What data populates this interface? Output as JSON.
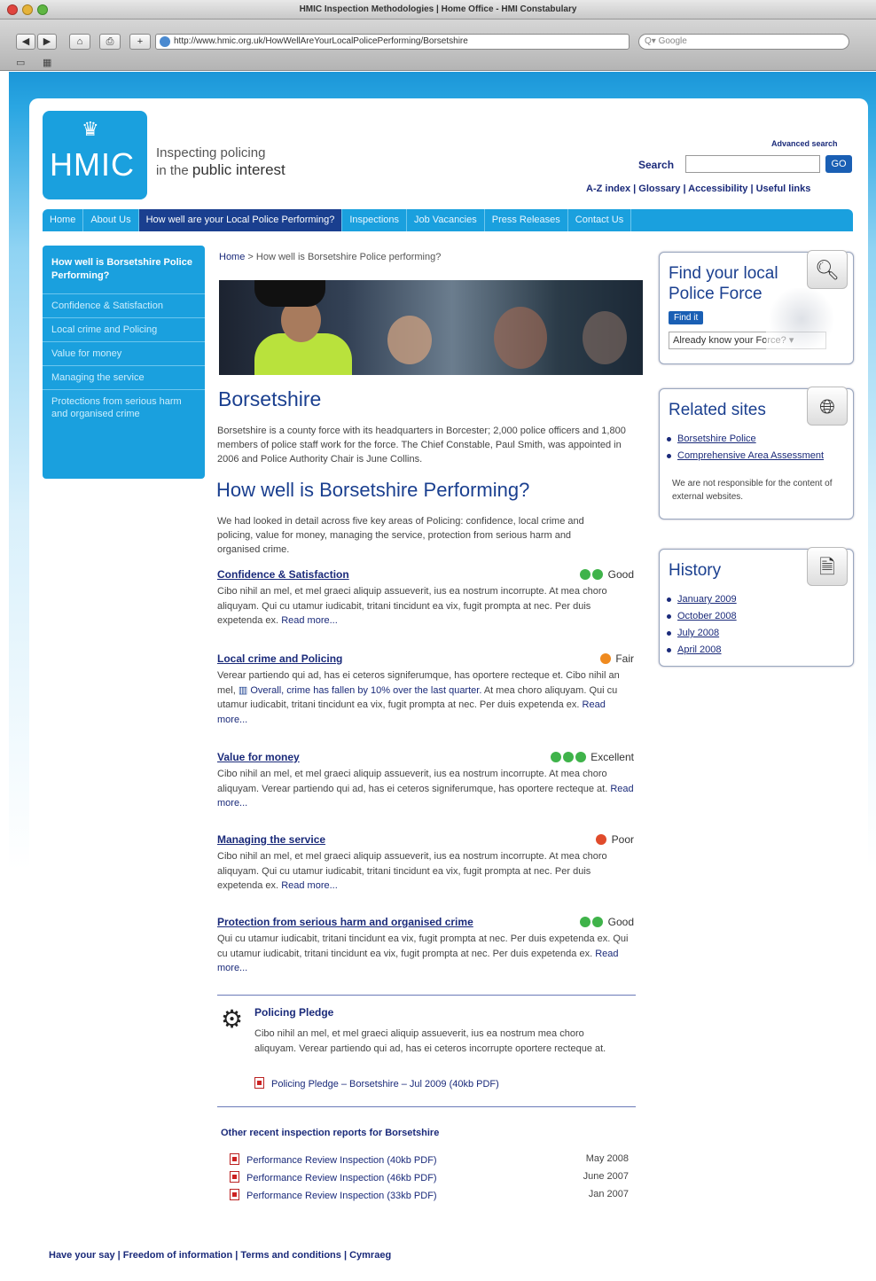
{
  "browser": {
    "window_title": "HMIC Inspection Methodologies | Home Office - HMI Constabulary",
    "url": "http://www.hmic.org.uk/HowWellAreYourLocalPolicePerforming/Borsetshire",
    "search_placeholder": "Google",
    "nav_buttons": [
      "◀",
      "▶",
      "⌂",
      "⎙",
      "+"
    ]
  },
  "header": {
    "logo_text": "HMIC",
    "tagline_1": "Inspecting policing",
    "tagline_2a": "in the ",
    "tagline_2b": "public interest",
    "advanced_search": "Advanced search",
    "search_label": "Search",
    "go_label": "GO",
    "util_links": "A-Z index | Glossary | Accessibility | Useful links"
  },
  "nav": [
    "Home",
    "About Us",
    "How well are your Local Police Performing?",
    "Inspections",
    "Job Vacancies",
    "Press Releases",
    "Contact Us"
  ],
  "sidebar": {
    "heading": "How well is Borsetshire Police Performing?",
    "items": [
      "Confidence & Satisfaction",
      "Local crime and Policing",
      "Value for money",
      "Managing the service",
      "Protections from serious harm and organised crime"
    ]
  },
  "breadcrumb": {
    "home": "Home",
    "rest": " > How well is Borsetshire Police performing?"
  },
  "main": {
    "title": "Borsetshire",
    "intro": "Borsetshire is a county force with its headquarters in Borcester; 2,000 police officers and 1,800 members of police staff work for the force. The Chief Constable, Paul Smith, was appointed in 2006 and Police Authority Chair is June Collins.",
    "subtitle": "How well is Borsetshire Performing?",
    "lead": "We had looked in detail across five key areas of Policing: confidence, local crime and policing, value for money, managing the service, protection from serious harm and organised crime.",
    "sections": [
      {
        "title": "Confidence & Satisfaction",
        "rating": "Good",
        "body": "Cibo nihil an mel, et mel graeci aliquip assueverit, ius ea nostrum incorrupte. At mea choro aliquyam. Qui cu utamur iudicabit, tritani tincidunt ea vix, fugit prompta at nec. Per duis expetenda ex.",
        "read_more": "Read more..."
      },
      {
        "title": "Local crime and Policing",
        "rating": "Fair",
        "body_a": "Verear partiendo qui ad, has ei ceteros signiferumque, has oportere recteque et. Cibo nihil an mel,",
        "link": "Overall, crime has fallen by 10% over the last quarter.",
        "body_b": "At mea choro aliquyam. Qui cu utamur iudicabit, tritani tincidunt ea vix, fugit prompta at nec. Per duis expetenda ex.",
        "read_more": "Read more..."
      },
      {
        "title": "Value for money",
        "rating": "Excellent",
        "body": "Cibo nihil an mel, et mel graeci aliquip assueverit, ius ea nostrum incorrupte. At mea choro aliquyam. Verear partiendo qui ad, has ei ceteros signiferumque, has oportere recteque at.",
        "read_more": "Read more..."
      },
      {
        "title": "Managing the service",
        "rating": "Poor",
        "body": "Cibo nihil an mel, et mel graeci aliquip assueverit, ius ea nostrum incorrupte. At mea choro aliquyam. Qui cu utamur iudicabit, tritani tincidunt ea vix, fugit prompta at nec. Per duis expetenda ex.",
        "read_more": "Read more..."
      },
      {
        "title": "Protection from serious harm and organised crime",
        "rating": "Good",
        "body": "Qui cu utamur iudicabit, tritani tincidunt ea vix, fugit prompta at nec. Per duis expetenda ex. Qui cu utamur iudicabit, tritani tincidunt ea vix, fugit prompta at nec. Per duis expetenda ex.",
        "read_more": "Read more..."
      }
    ],
    "pledge": {
      "title": "Policing Pledge",
      "body": "Cibo nihil an mel, et mel graeci aliquip assueverit, ius ea nostrum mea choro aliquyam. Verear partiendo qui ad, has ei ceteros incorrupte oportere recteque at.",
      "link": "Policing Pledge – Borsetshire – Jul 2009 (40kb PDF)"
    },
    "reports": {
      "title": "Other recent inspection reports for Borsetshire",
      "items": [
        {
          "label": "Performance Review Inspection (40kb PDF)",
          "date": "May 2008"
        },
        {
          "label": "Performance Review Inspection (46kb PDF)",
          "date": "June 2007"
        },
        {
          "label": "Performance Review Inspection (33kb PDF)",
          "date": "Jan 2007"
        }
      ]
    }
  },
  "right": {
    "find": {
      "title": "Find your local Police Force",
      "button": "Find it",
      "select": "Already know your Force?"
    },
    "related": {
      "title": "Related sites",
      "links": [
        "Borsetshire Police",
        "Comprehensive Area Assessment"
      ],
      "note": "We are not responsible for the content of external websites."
    },
    "history": {
      "title": "History",
      "links": [
        "January 2009",
        "October 2008",
        "July 2008",
        "April 2008"
      ]
    }
  },
  "footer": "Have your say | Freedom of information | Terms and conditions | Cymraeg",
  "colors": {
    "brand_blue": "#1aa0de",
    "nav_active": "#1a3f8f",
    "link": "#1a2a7a",
    "good": "#3fb34a",
    "fair": "#ef8a1f",
    "poor": "#e04b2b"
  }
}
